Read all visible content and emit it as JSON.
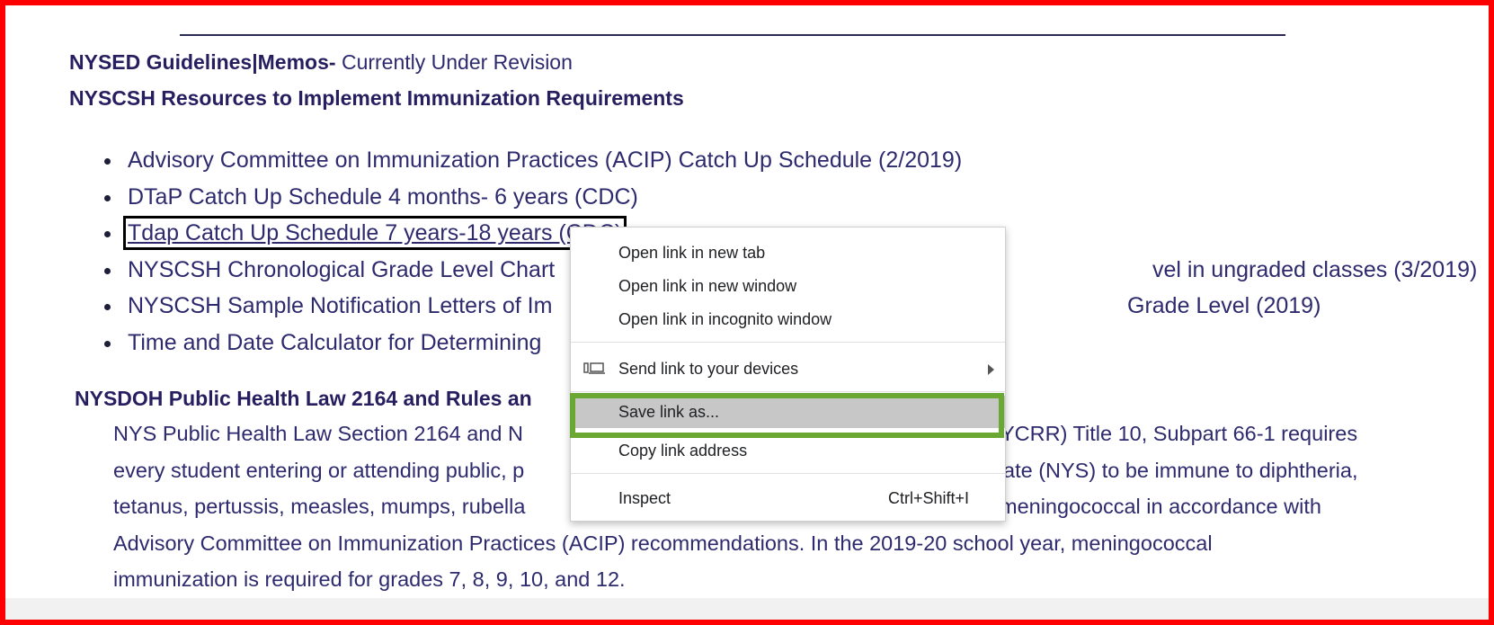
{
  "divider": "",
  "guidelines": {
    "bold": "NYSED Guidelines|Memos-",
    "normal": " Currently Under Revision"
  },
  "resources_heading": "NYSCSH Resources to Implement Immunization Requirements",
  "resources": [
    {
      "text": "Advisory Committee on Immunization Practices (ACIP) Catch Up Schedule (2/2019)"
    },
    {
      "text": "DTaP Catch Up Schedule 4 months- 6 years (CDC)"
    },
    {
      "text": "Tdap Catch Up Schedule 7 years-18 years (CDC)"
    },
    {
      "text": "NYSCSH Chronological Grade Level Chart",
      "tail": "vel in ungraded classes (3/2019)"
    },
    {
      "text": "NYSCSH Sample Notification Letters of Im",
      "tail": "Grade Level (2019)"
    },
    {
      "text": "Time and Date Calculator for Determining"
    }
  ],
  "doh_heading": "NYSDOH Public Health Law 2164 and Rules an",
  "paragraph": {
    "line1a": "NYS Public Health Law Section 2164 and N",
    "line1b": "YCRR) Title 10, Subpart 66-1 requires",
    "line2a": "every student entering or attending public, p",
    "line2b": "ate (NYS) to be immune to diphtheria,",
    "line3a": "tetanus, pertussis, measles, mumps, rubella",
    "line3b": "meningococcal in accordance with",
    "line4": "Advisory Committee on Immunization Practices (ACIP) recommendations. In the 2019-20 school year, meningococcal",
    "line5": "immunization is required for grades 7, 8, 9, 10, and 12."
  },
  "context_menu": {
    "open_new_tab": "Open link in new tab",
    "open_new_window": "Open link in new window",
    "open_incognito": "Open link in incognito window",
    "send_to_devices": "Send link to your devices",
    "save_link_as": "Save link as...",
    "copy_link_address": "Copy link address",
    "inspect": "Inspect",
    "inspect_shortcut": "Ctrl+Shift+I"
  },
  "colors": {
    "highlight_border": "#6aa733",
    "frame": "#ff0000",
    "text": "#2d2a6e"
  }
}
